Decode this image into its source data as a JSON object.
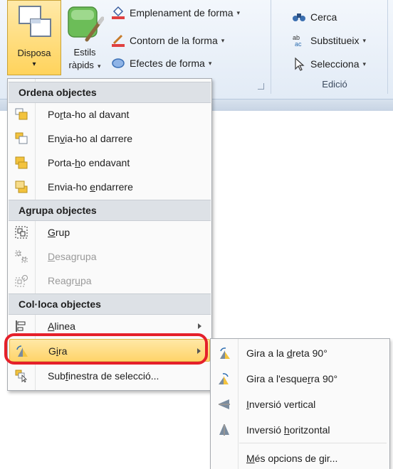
{
  "ribbon": {
    "arrange_button": {
      "label": "Disposa",
      "caret": "▾"
    },
    "quick_styles_button": {
      "label_line1": "Estils",
      "label_line2": "ràpids",
      "caret": "▾"
    },
    "shape_fill": {
      "label": "Emplenament de forma",
      "caret": "▾"
    },
    "shape_outline": {
      "label": "Contorn de la forma",
      "caret": "▾"
    },
    "shape_effects": {
      "label": "Efectes de forma",
      "caret": "▾"
    },
    "find": {
      "label": "Cerca"
    },
    "replace": {
      "label": "Substitueix",
      "caret": "▾"
    },
    "select": {
      "label": "Selecciona",
      "caret": "▾"
    },
    "editing_group_label": "Edició"
  },
  "arrange_menu": {
    "sections": [
      {
        "header": "Ordena objectes"
      },
      {
        "header": "Agrupa objectes"
      },
      {
        "header": "Col·loca objectes"
      }
    ],
    "order_items": [
      {
        "pre": "Po",
        "u": "r",
        "post": "ta-ho al davant",
        "disabled": false
      },
      {
        "pre": "En",
        "u": "v",
        "post": "ia-ho al darrere",
        "disabled": false
      },
      {
        "pre": "Porta-",
        "u": "h",
        "post": "o endavant",
        "disabled": false
      },
      {
        "pre": "Envia-ho ",
        "u": "e",
        "post": "ndarrere",
        "disabled": false
      }
    ],
    "group_items": [
      {
        "pre": "",
        "u": "G",
        "post": "rup",
        "disabled": false
      },
      {
        "pre": "",
        "u": "D",
        "post": "esagrupa",
        "disabled": true
      },
      {
        "pre": "Reagr",
        "u": "u",
        "post": "pa",
        "disabled": true
      }
    ],
    "position_items": [
      {
        "pre": "",
        "u": "A",
        "post": "linea",
        "has_submenu": true
      },
      {
        "pre": "G",
        "u": "i",
        "post": "ra",
        "has_submenu": true,
        "highlighted": true
      },
      {
        "pre": "Sub",
        "u": "f",
        "post": "inestra de selecció...",
        "has_submenu": false
      }
    ]
  },
  "rotate_submenu": {
    "items": [
      {
        "pre": "Gira a la ",
        "u": "d",
        "post": "reta 90°"
      },
      {
        "pre": "Gira a l'esque",
        "u": "r",
        "post": "ra 90°"
      },
      {
        "pre": "",
        "u": "I",
        "post": "nversió vertical"
      },
      {
        "pre": "Inversió ",
        "u": "h",
        "post": "oritzontal"
      },
      {
        "pre": "",
        "u": "M",
        "post": "és opcions de gir..."
      }
    ]
  },
  "colors": {
    "highlight": "#ffd46a",
    "annotation_outline": "#e5202a",
    "section_header": "#dde1e6"
  }
}
